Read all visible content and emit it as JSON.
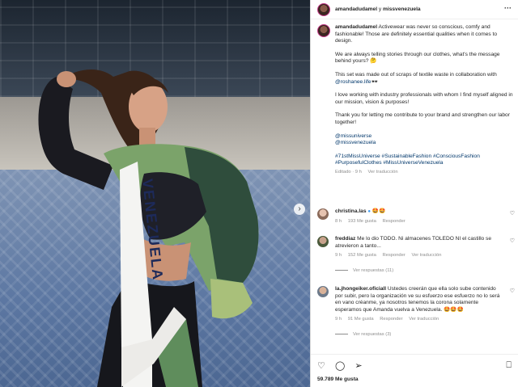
{
  "post": {
    "header": {
      "author": "amandadudamel",
      "connector": "y",
      "collaborator": "missvenezuela",
      "more_icon": "more-horizontal-icon"
    },
    "photo": {
      "sash_text": "VENEZUELA",
      "next_icon": "chevron-right-icon"
    },
    "caption": {
      "author": "amandadudamel",
      "p1": "Activewear was never so conscious, comfy and fashionable! Those are definitely essential qualities when it comes to design.",
      "p2": "We are always telling stories through our clothes, what's the message behind yours? 🤔",
      "p3_prefix": "This set was made out of scraps of textile waste in collaboration with ",
      "p3_link": "@roshanee.life",
      "p3_suffix": "🕶",
      "p4": "I love working with industry professionals with whom I find myself aligned in our mission, vision & purposes!",
      "p5": "Thank you for letting me contribute to your brand and strengthen our labor together!",
      "mention1": "@missuniverse",
      "mention2": "@missvenezuela",
      "hashtags": "#71stMissUniverse #SustainableFashion #ConsciousFashion #PurposefulClothes #MissUniverseVenezuela",
      "meta_edited": "Editado · 9 h",
      "meta_translate": "Ver traducción"
    },
    "comments": [
      {
        "user": "christina.las",
        "text": "🤩🤩",
        "time": "8 h",
        "likes": "193 Me gusta",
        "reply": "Responder"
      },
      {
        "user": "freddiaz",
        "text": "Me lo dio TODO. Ni almacenes TOLEDO NI el castillo se atrevieron a tanto...",
        "time": "9 h",
        "likes": "152 Me gusta",
        "reply": "Responder",
        "translate": "Ver traducción",
        "replies": "Ver respuestas (11)"
      },
      {
        "user": "la.jhongeiker.oficiall",
        "text": "Ustedes creerán que ella solo sube contenido por subir, pero la organización ve su esfuerzo ese esfuerzo no lo será en vano créanme, ya nosotros tenemos la corona solamente esperamos que Amanda vuelva a Venezuela. 🤩🤩🤩",
        "time": "9 h",
        "likes": "91 Me gusta",
        "reply": "Responder",
        "translate": "Ver traducción",
        "replies": "Ver respuestas (3)"
      }
    ],
    "footer": {
      "like_icon": "heart-icon",
      "comment_icon": "comment-icon",
      "share_icon": "paper-plane-icon",
      "save_icon": "bookmark-icon",
      "likes": "59.789 Me gusta"
    }
  }
}
